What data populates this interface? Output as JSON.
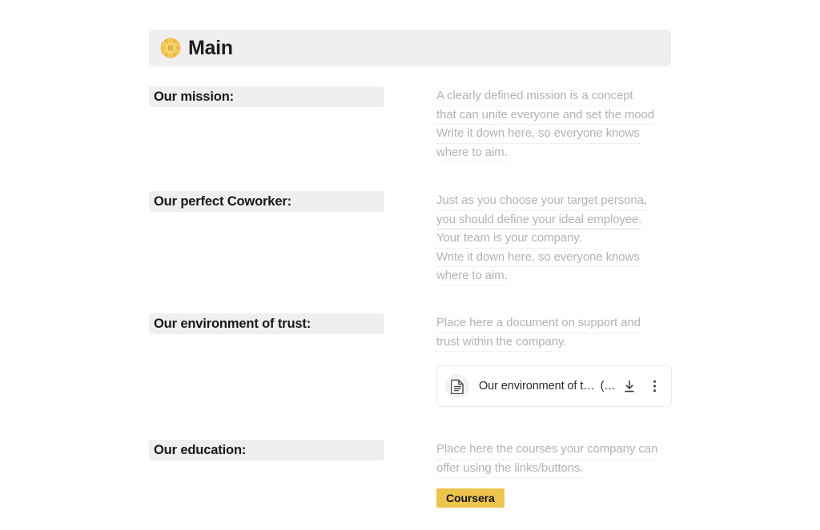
{
  "header": {
    "icon": "rosette-emoji",
    "title": "Main"
  },
  "sections": [
    {
      "label": "Our mission:",
      "hint_lines": [
        "A clearly defined mission is a concept",
        "that can unite everyone and set the mood",
        "Write it down here, so everyone knows",
        "where to aim."
      ]
    },
    {
      "label": "Our perfect Coworker:",
      "hint_lines": [
        "Just as you choose your target persona,",
        "you should define your ideal employee.",
        "Your team is your company.",
        "Write it down here, so everyone knows",
        "where to aim."
      ]
    },
    {
      "label": "Our environment of trust:",
      "hint_lines": [
        "Place here a document on support and",
        "trust within the company."
      ],
      "file": {
        "name": "Our environment of t…",
        "size": "(…",
        "file_icon": "document-icon",
        "download_icon": "download-icon",
        "menu_icon": "more-vertical-icon"
      }
    },
    {
      "label": "Our education:",
      "hint_lines": [
        "Place here the courses your company can",
        "offer using the links/buttons."
      ],
      "button": {
        "label": "Coursera",
        "color": "#edc44c"
      }
    }
  ],
  "colors": {
    "label_background": "#efefef",
    "hint_text": "#b3b3b3",
    "accent": "#edc44c"
  }
}
